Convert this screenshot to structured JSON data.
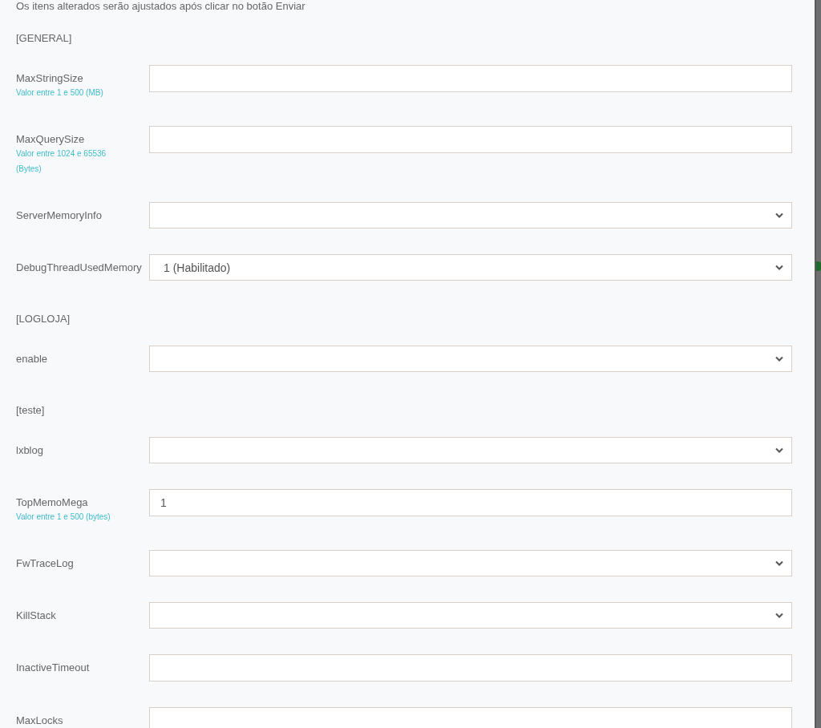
{
  "notice": "Os itens alterados serão ajustados após clicar no botão Enviar",
  "items": [
    {
      "kind": "section",
      "label": "[GENERAL]"
    },
    {
      "kind": "input",
      "label": "MaxStringSize",
      "hint": "Valor entre 1 e 500 (MB)"
    },
    {
      "kind": "input",
      "label": "MaxQuerySize",
      "hint": "Valor entre 1024 e 65536 (Bytes)"
    },
    {
      "kind": "select",
      "label": "ServerMemoryInfo"
    },
    {
      "kind": "select",
      "label": "DebugThreadUsedMemory",
      "value": "1 (Habilitado)"
    },
    {
      "kind": "section",
      "label": "[LOGLOJA]"
    },
    {
      "kind": "select",
      "label": "enable"
    },
    {
      "kind": "section",
      "label": "[teste]"
    },
    {
      "kind": "select",
      "label": "lxblog"
    },
    {
      "kind": "input",
      "label": "TopMemoMega",
      "hint": "Valor entre 1 e 500 (bytes)",
      "value": "1"
    },
    {
      "kind": "select",
      "label": "FwTraceLog"
    },
    {
      "kind": "select",
      "label": "KillStack"
    },
    {
      "kind": "input",
      "label": "InactiveTimeout"
    },
    {
      "kind": "input",
      "label": "MaxLocks"
    }
  ]
}
